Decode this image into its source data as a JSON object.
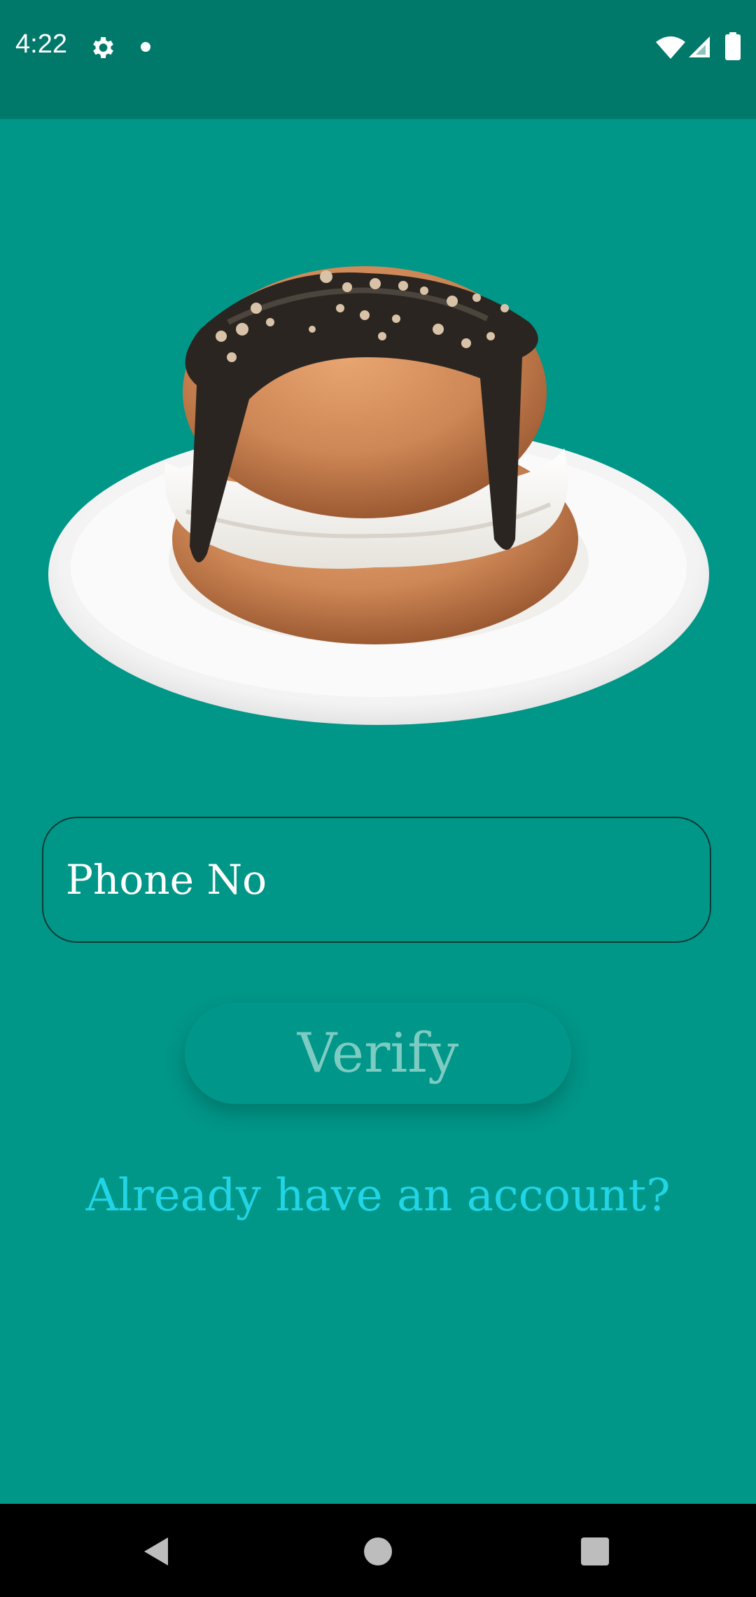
{
  "status_bar": {
    "time": "4:22",
    "icons": [
      "gear-icon",
      "notification-dot-icon",
      "wifi-icon",
      "signal-icon",
      "battery-icon"
    ]
  },
  "hero": {
    "icon": "cream-bun-image"
  },
  "form": {
    "phone_placeholder": "Phone No",
    "phone_value": "",
    "verify_label": "Verify",
    "login_link": "Already have an account?"
  },
  "nav_bar": {
    "icons": [
      "back-icon",
      "home-icon",
      "recents-icon"
    ]
  },
  "colors": {
    "background": "#009688",
    "status_bar": "#00796b",
    "link": "#21d4e6",
    "button_text": "#7ecbc2"
  }
}
